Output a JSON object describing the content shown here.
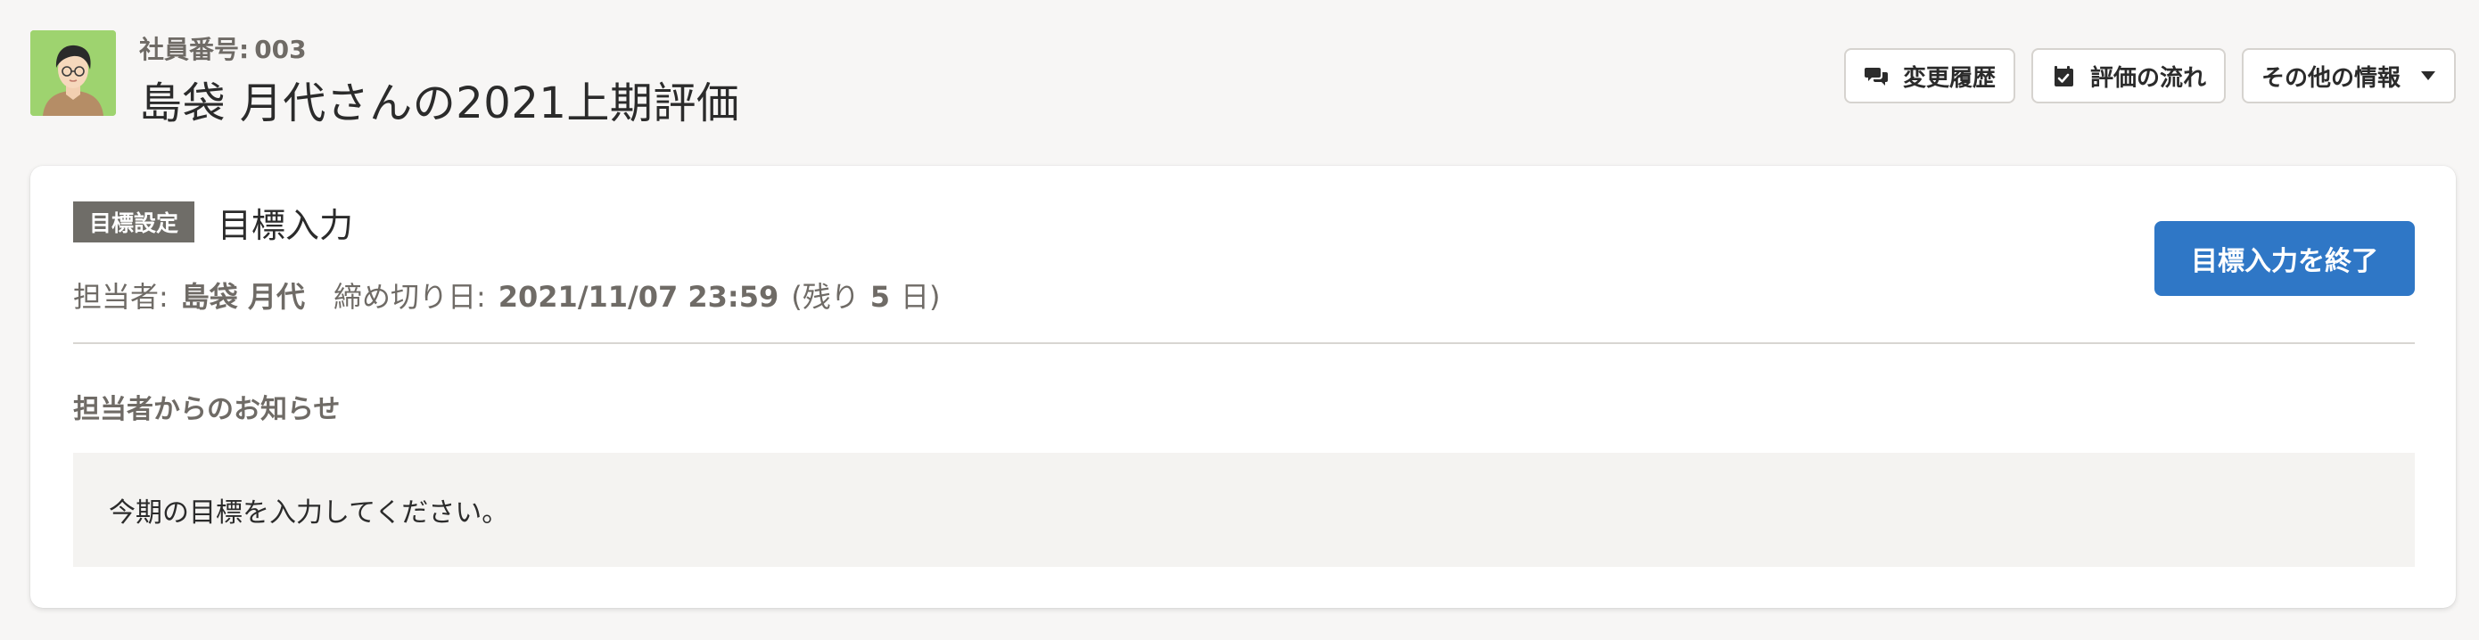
{
  "header": {
    "employee_number_label": "社員番号:",
    "employee_number": "003",
    "title": "島袋 月代さんの2021上期評価"
  },
  "actions": {
    "history": {
      "label": "変更履歴",
      "icon": "comments-icon"
    },
    "flow": {
      "label": "評価の流れ",
      "icon": "calendar-check-icon"
    },
    "other": {
      "label": "その他の情報",
      "icon": "chevron-down-icon"
    }
  },
  "card": {
    "phase_badge": "目標設定",
    "phase_title": "目標入力",
    "assignee_label": "担当者:",
    "assignee_name": "島袋 月代",
    "deadline_label": "締め切り日:",
    "deadline": "2021/11/07 23:59",
    "remaining_prefix": "(残り",
    "remaining_days": "5",
    "remaining_suffix": "日)",
    "finish_button": "目標入力を終了",
    "notice_heading": "担当者からのお知らせ",
    "notice_text": "今期の目標を入力してください。"
  },
  "colors": {
    "primary": "#2f77c6",
    "badge": "#6f6d68",
    "page_bg": "#f7f6f5",
    "avatar_bg": "#9ed36f"
  }
}
